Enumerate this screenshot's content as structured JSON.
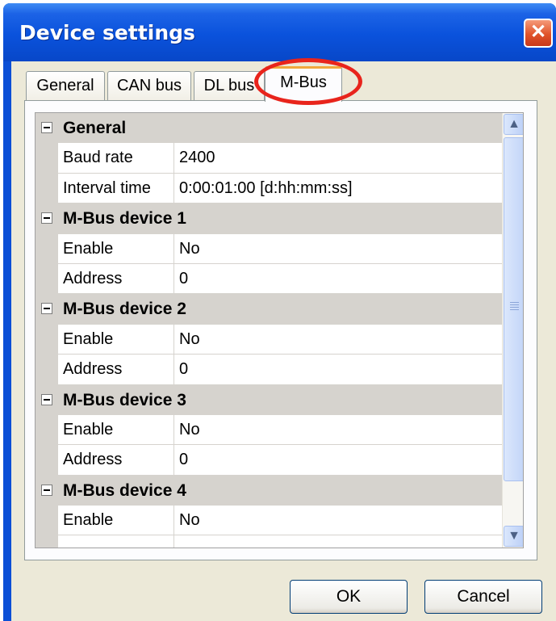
{
  "window": {
    "title": "Device settings",
    "close_glyph": "✕"
  },
  "tabs": [
    {
      "label": "General",
      "active": false
    },
    {
      "label": "CAN bus",
      "active": false
    },
    {
      "label": "DL bus",
      "active": false
    },
    {
      "label": "M-Bus",
      "active": true
    }
  ],
  "property_grid": {
    "rows": [
      {
        "kind": "section",
        "label": "General"
      },
      {
        "kind": "property",
        "name": "Baud rate",
        "value": "2400"
      },
      {
        "kind": "property",
        "name": "Interval time",
        "value": "0:00:01:00 [d:hh:mm:ss]"
      },
      {
        "kind": "section",
        "label": "M-Bus device 1"
      },
      {
        "kind": "property",
        "name": "Enable",
        "value": "No"
      },
      {
        "kind": "property",
        "name": "Address",
        "value": "0"
      },
      {
        "kind": "section",
        "label": "M-Bus device 2"
      },
      {
        "kind": "property",
        "name": "Enable",
        "value": "No"
      },
      {
        "kind": "property",
        "name": "Address",
        "value": "0"
      },
      {
        "kind": "section",
        "label": "M-Bus device 3"
      },
      {
        "kind": "property",
        "name": "Enable",
        "value": "No"
      },
      {
        "kind": "property",
        "name": "Address",
        "value": "0"
      },
      {
        "kind": "section",
        "label": "M-Bus device 4"
      },
      {
        "kind": "property",
        "name": "Enable",
        "value": "No"
      },
      {
        "kind": "property",
        "name": "",
        "value": ""
      }
    ]
  },
  "scrollbar": {
    "up_glyph": "▲",
    "down_glyph": "▼"
  },
  "buttons": {
    "ok_label": "OK",
    "cancel_label": "Cancel"
  },
  "colors": {
    "titlebar": "#0a52dc",
    "dialog_background": "#ece9d8",
    "section_background": "#d6d3ce",
    "active_tab_accent": "#f1a83c",
    "annotation_ring": "#e8241c"
  }
}
